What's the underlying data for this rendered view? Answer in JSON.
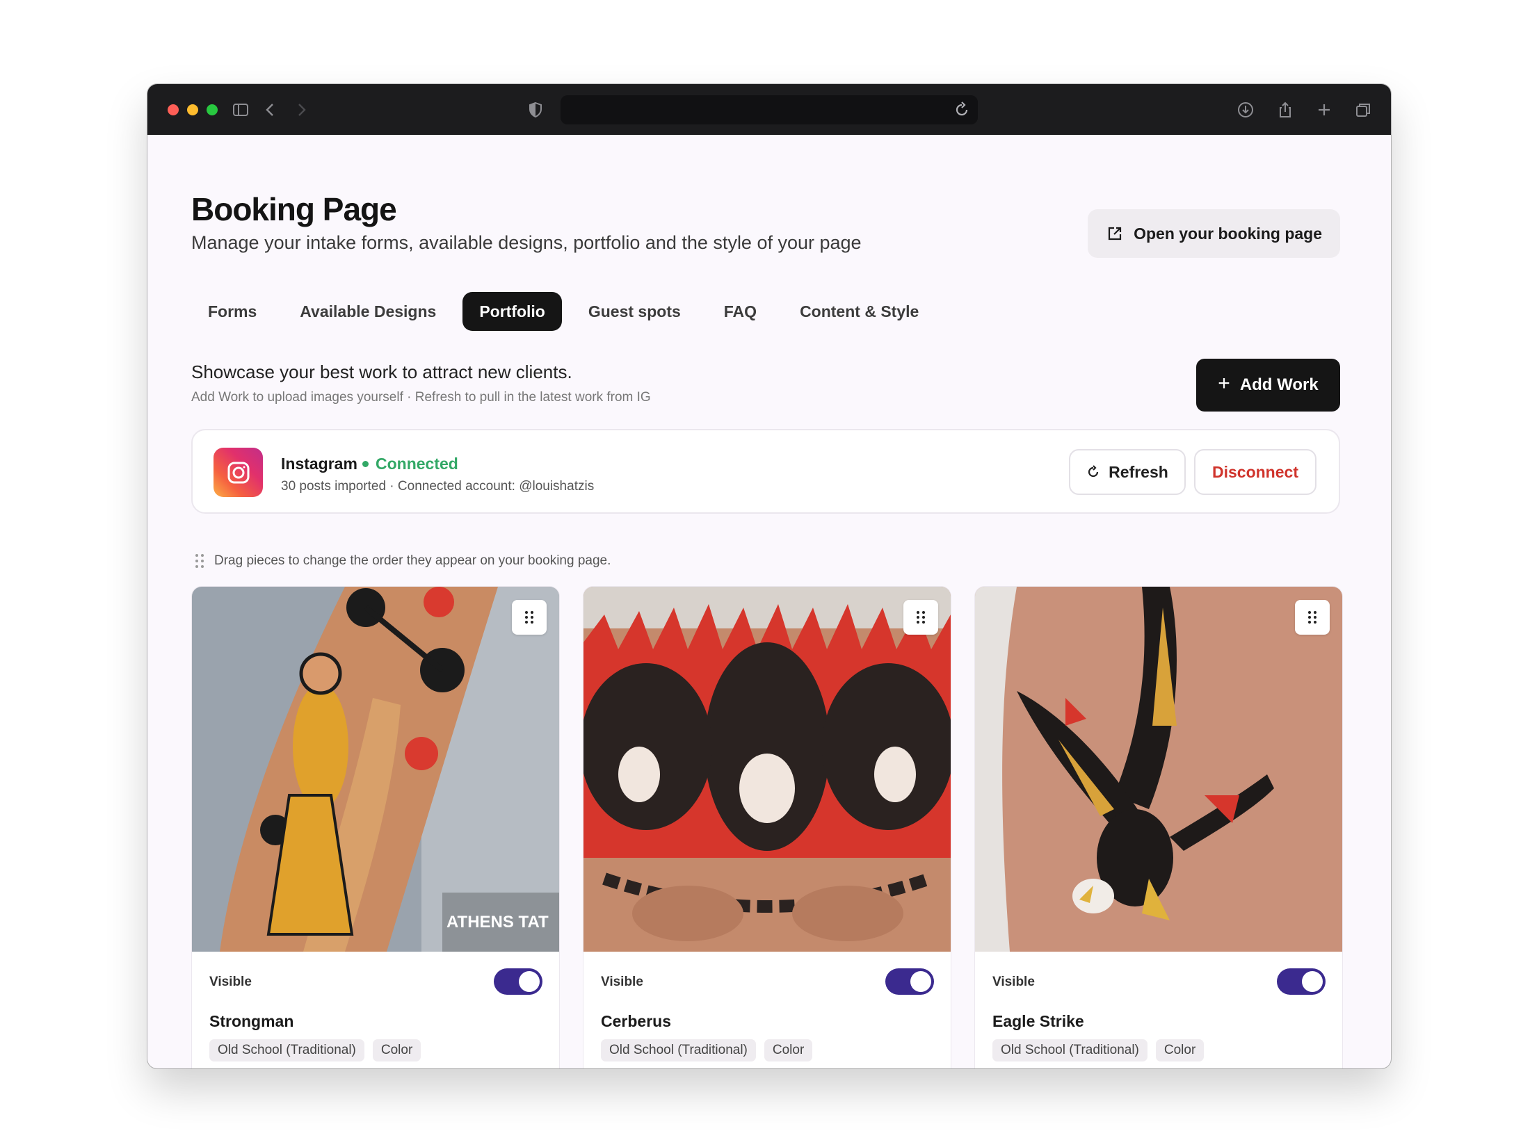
{
  "header": {
    "title": "Booking Page",
    "subtitle": "Manage your intake forms, available designs, portfolio and the style of your page",
    "open_button": "Open your booking page"
  },
  "tabs": [
    {
      "label": "Forms",
      "active": false
    },
    {
      "label": "Available Designs",
      "active": false
    },
    {
      "label": "Portfolio",
      "active": true
    },
    {
      "label": "Guest spots",
      "active": false
    },
    {
      "label": "FAQ",
      "active": false
    },
    {
      "label": "Content & Style",
      "active": false
    }
  ],
  "portfolio": {
    "heading": "Showcase your best work to attract new clients.",
    "subheading": "Add Work to upload images yourself · Refresh to pull in the latest work from IG",
    "add_button": "Add Work",
    "drag_hint": "Drag pieces to change the order they appear on your booking page."
  },
  "instagram": {
    "name": "Instagram",
    "status": "Connected",
    "meta": "30 posts imported · Connected account: @louishatzis",
    "refresh_button": "Refresh",
    "disconnect_button": "Disconnect"
  },
  "cards": [
    {
      "visible_label": "Visible",
      "visible": true,
      "title": "Strongman",
      "tags": [
        "Old School (Traditional)",
        "Color"
      ],
      "watermark": "ATHENS TAT"
    },
    {
      "visible_label": "Visible",
      "visible": true,
      "title": "Cerberus",
      "tags": [
        "Old School (Traditional)",
        "Color"
      ]
    },
    {
      "visible_label": "Visible",
      "visible": true,
      "title": "Eagle Strike",
      "tags": [
        "Old School (Traditional)",
        "Color"
      ]
    }
  ],
  "colors": {
    "accent": "#3b2a8f",
    "connected": "#32a866",
    "danger": "#d0342c",
    "dark_button": "#151515"
  },
  "icons": [
    "sidebar-icon",
    "back-icon",
    "forward-icon",
    "shield-icon",
    "reload-icon",
    "download-icon",
    "share-icon",
    "new-tab-icon",
    "tabs-overview-icon",
    "external-link-icon",
    "plus-icon",
    "instagram-icon",
    "refresh-icon",
    "drag-handle-icon"
  ]
}
